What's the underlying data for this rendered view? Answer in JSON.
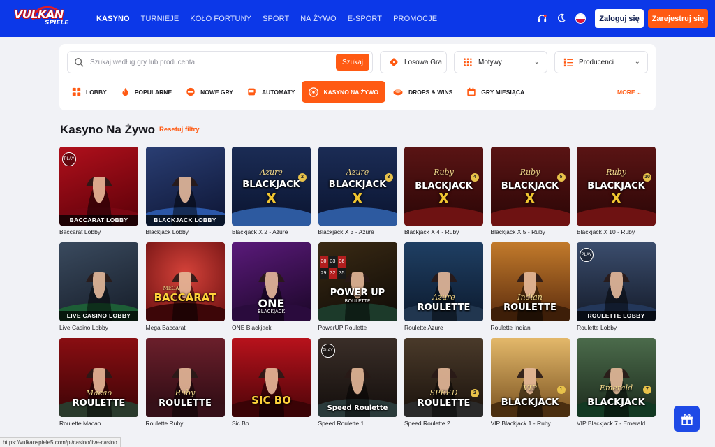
{
  "brand": {
    "line1": "VULKAN",
    "line2": "SPIELE"
  },
  "nav": [
    "KASYNO",
    "TURNIEJE",
    "KOŁO FORTUNY",
    "SPORT",
    "NA ŻYWO",
    "E-SPORT",
    "PROMOCJE"
  ],
  "header": {
    "login": "Zaloguj się",
    "register": "Zarejestruj się"
  },
  "search": {
    "placeholder": "Szukaj według gry lub producenta",
    "button": "Szukaj"
  },
  "filters": {
    "random": "Losowa Gra",
    "themes": "Motywy",
    "providers": "Producenci"
  },
  "categories": [
    "LOBBY",
    "POPULARNE",
    "NOWE GRY",
    "AUTOMATY",
    "KASYNO NA ŻYWO",
    "DROPS & WINS",
    "GRY MIESIĄCA"
  ],
  "more": "MORE",
  "page": {
    "title": "Kasyno Na Żywo",
    "reset": "Resetuj filtry"
  },
  "games": [
    {
      "name": "Baccarat Lobby",
      "band": "BACCARAT LOBBY"
    },
    {
      "name": "Blackjack Lobby",
      "band": "BLACKJACK LOBBY"
    },
    {
      "name": "Blackjack X 2 - Azure",
      "sub": "Azure",
      "ttl": "BLACKJACK",
      "badge": "2"
    },
    {
      "name": "Blackjack X 3 - Azure",
      "sub": "Azure",
      "ttl": "BLACKJACK",
      "badge": "3"
    },
    {
      "name": "Blackjack X 4 - Ruby",
      "sub": "Ruby",
      "ttl": "BLACKJACK",
      "badge": "4"
    },
    {
      "name": "Blackjack X 5 - Ruby",
      "sub": "Ruby",
      "ttl": "BLACKJACK",
      "badge": "5"
    },
    {
      "name": "Blackjack X 10 - Ruby",
      "sub": "Ruby",
      "ttl": "BLACKJACK",
      "badge": "10"
    },
    {
      "name": "Live Casino Lobby",
      "band": "LIVE CASINO LOBBY"
    },
    {
      "name": "Mega Baccarat",
      "ttl": "BACCARAT",
      "sub": "MEGA"
    },
    {
      "name": "ONE Blackjack",
      "ttl": "ONE",
      "sub": "BLACKJACK"
    },
    {
      "name": "PowerUP Roulette",
      "ttl": "POWER UP",
      "sub": "ROULETTE",
      "nums": [
        "30",
        "33",
        "36",
        "29",
        "32",
        "35"
      ]
    },
    {
      "name": "Roulette Azure",
      "sub": "Azure",
      "ttl": "ROULETTE"
    },
    {
      "name": "Roulette Indian",
      "sub": "Indian",
      "ttl": "ROULETTE"
    },
    {
      "name": "Roulette Lobby",
      "band": "ROULETTE LOBBY"
    },
    {
      "name": "Roulette Macao",
      "sub": "Macao",
      "ttl": "ROULETTE"
    },
    {
      "name": "Roulette Ruby",
      "sub": "Ruby",
      "ttl": "ROULETTE"
    },
    {
      "name": "Sic Bo",
      "ttl": "SIC BO"
    },
    {
      "name": "Speed Roulette 1",
      "ttl": "Speed Roulette"
    },
    {
      "name": "Speed Roulette 2",
      "sub": "SPEED",
      "ttl": "ROULETTE",
      "badge": "2"
    },
    {
      "name": "VIP Blackjack 1 - Ruby",
      "sub": "VIP",
      "ttl": "BLACKJACK",
      "badge": "1"
    },
    {
      "name": "VIP Blackjack 7 - Emerald",
      "sub": "Emerald",
      "ttl": "BLACKJACK",
      "badge": "7"
    }
  ],
  "play_badge": "PLAY",
  "status_url": "https://vulkanspiele5.com/pl/casino/live-casino",
  "colors": {
    "brand_blue": "#0c38e8",
    "accent_orange": "#ff5a13"
  }
}
